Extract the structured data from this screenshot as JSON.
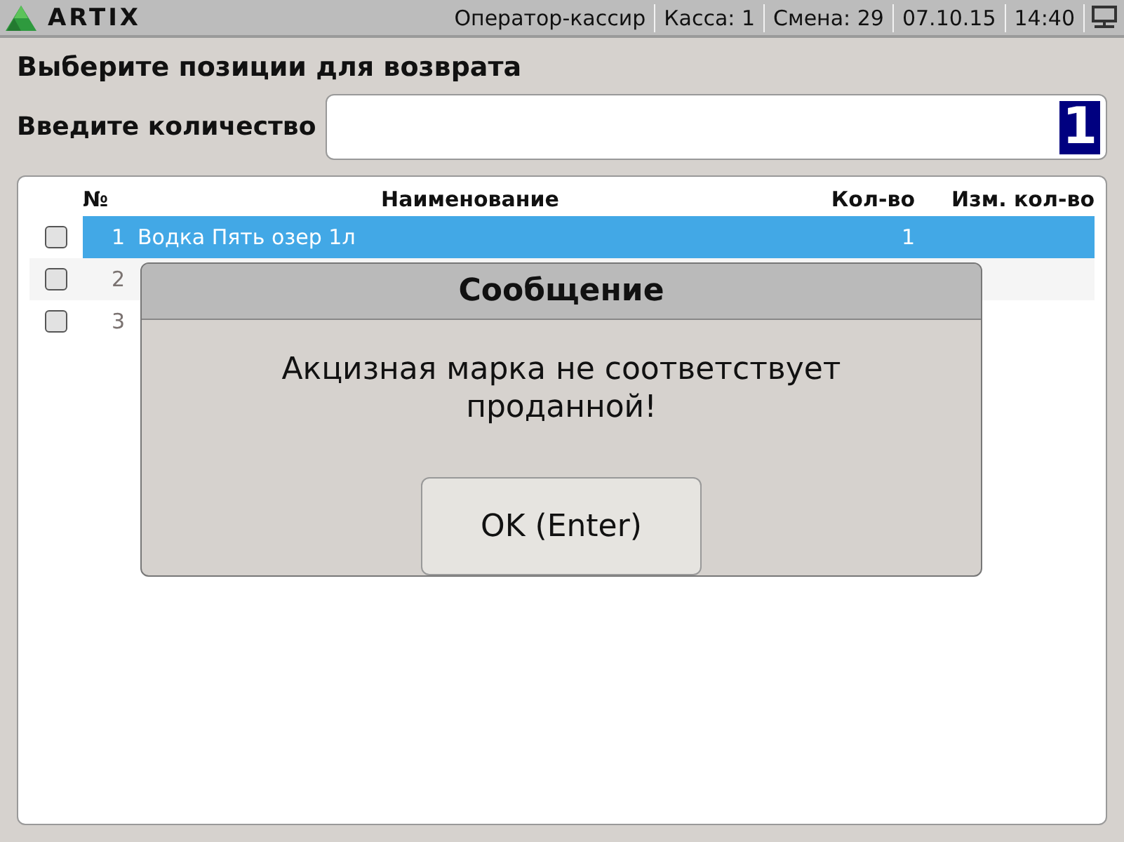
{
  "top_bar": {
    "logo": "ARTIX",
    "items": [
      "Оператор-кассир",
      "Касса: 1",
      "Смена: 29",
      "07.10.15",
      "14:40"
    ]
  },
  "heading": "Выберите позиции для возврата",
  "quantity": {
    "label": "Введите количество",
    "value": "1"
  },
  "table": {
    "columns": [
      "№",
      "Наименование",
      "Кол-во",
      "Изм. кол-во"
    ],
    "rows": [
      {
        "number": "1",
        "name": "Водка Пять озер 1л",
        "qty": "1",
        "checked": false,
        "selected": true
      },
      {
        "number": "2",
        "checked": false,
        "selected": false
      },
      {
        "number": "3",
        "checked": false,
        "selected": false
      }
    ]
  },
  "dialog": {
    "title": "Сообщение",
    "message": "Акцизная марка не соответствует проданной!",
    "button": "OK (Enter)"
  }
}
